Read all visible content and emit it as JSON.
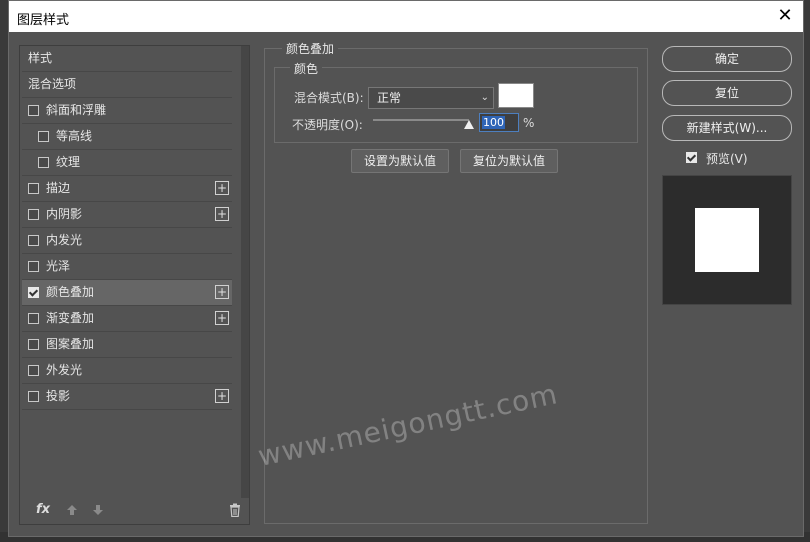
{
  "window": {
    "title": "图层样式",
    "close_symbol": "✕"
  },
  "styles_list": {
    "items": [
      {
        "label": "样式",
        "checkbox": false,
        "checked": false,
        "plus": false,
        "indent": false
      },
      {
        "label": "混合选项",
        "checkbox": false,
        "checked": false,
        "plus": false,
        "indent": false
      },
      {
        "label": "斜面和浮雕",
        "checkbox": true,
        "checked": false,
        "plus": false,
        "indent": false
      },
      {
        "label": "等高线",
        "checkbox": true,
        "checked": false,
        "plus": false,
        "indent": true
      },
      {
        "label": "纹理",
        "checkbox": true,
        "checked": false,
        "plus": false,
        "indent": true
      },
      {
        "label": "描边",
        "checkbox": true,
        "checked": false,
        "plus": true,
        "indent": false
      },
      {
        "label": "内阴影",
        "checkbox": true,
        "checked": false,
        "plus": true,
        "indent": false
      },
      {
        "label": "内发光",
        "checkbox": true,
        "checked": false,
        "plus": false,
        "indent": false
      },
      {
        "label": "光泽",
        "checkbox": true,
        "checked": false,
        "plus": false,
        "indent": false
      },
      {
        "label": "颜色叠加",
        "checkbox": true,
        "checked": true,
        "plus": true,
        "indent": false,
        "selected": true
      },
      {
        "label": "渐变叠加",
        "checkbox": true,
        "checked": false,
        "plus": true,
        "indent": false
      },
      {
        "label": "图案叠加",
        "checkbox": true,
        "checked": false,
        "plus": false,
        "indent": false
      },
      {
        "label": "外发光",
        "checkbox": true,
        "checked": false,
        "plus": false,
        "indent": false
      },
      {
        "label": "投影",
        "checkbox": true,
        "checked": false,
        "plus": true,
        "indent": false
      }
    ],
    "footer": {
      "fx_label": "fx",
      "up_icon": "arrow-up-icon",
      "down_icon": "arrow-down-icon",
      "trash_icon": "trash-icon"
    }
  },
  "color_overlay": {
    "section_title": "颜色叠加",
    "group_title": "颜色",
    "blend_mode_label": "混合模式(B):",
    "blend_mode_value": "正常",
    "swatch_color": "#ffffff",
    "opacity_label": "不透明度(O):",
    "opacity_value": "100",
    "opacity_unit": "%",
    "opacity_fraction": 1.0,
    "set_default_label": "设置为默认值",
    "reset_default_label": "复位为默认值"
  },
  "actions": {
    "ok_label": "确定",
    "reset_label": "复位",
    "new_style_label": "新建样式(W)...",
    "preview_label": "预览(V)",
    "preview_checked": true
  },
  "watermark": "www.meigongtt.com"
}
